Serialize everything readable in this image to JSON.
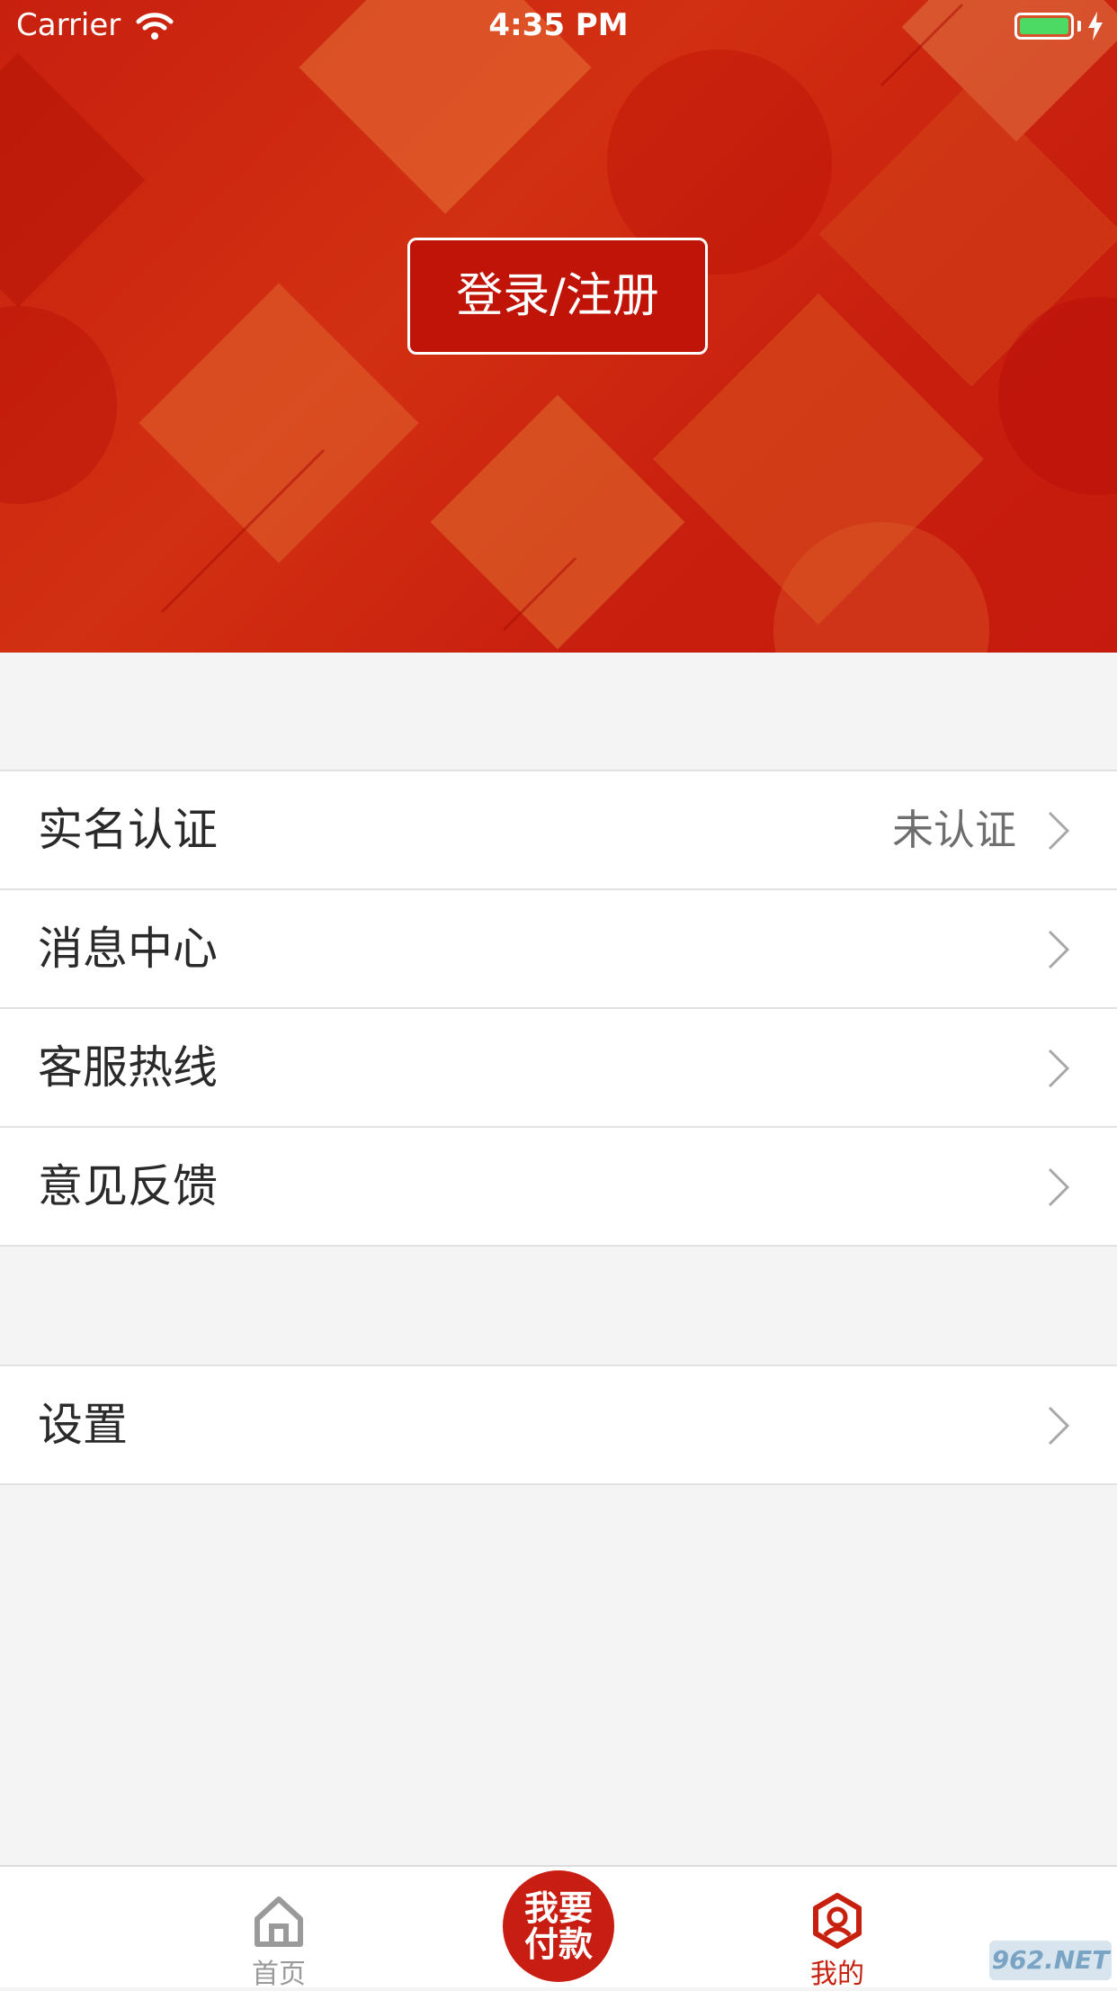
{
  "status_bar": {
    "carrier": "Carrier",
    "time": "4:35 PM"
  },
  "header": {
    "login_label": "登录/注册"
  },
  "menu": {
    "group1": [
      {
        "label": "实名认证",
        "value": "未认证"
      },
      {
        "label": "消息中心"
      },
      {
        "label": "客服热线"
      },
      {
        "label": "意见反馈"
      }
    ],
    "group2": [
      {
        "label": "设置"
      }
    ]
  },
  "tab_bar": {
    "home_label": "首页",
    "pay_label_line1": "我要",
    "pay_label_line2": "付款",
    "mine_label": "我的"
  },
  "watermark": "962.NET",
  "colors": {
    "accent": "#c8200f",
    "battery": "#4cd964",
    "background": "#f4f4f4"
  }
}
